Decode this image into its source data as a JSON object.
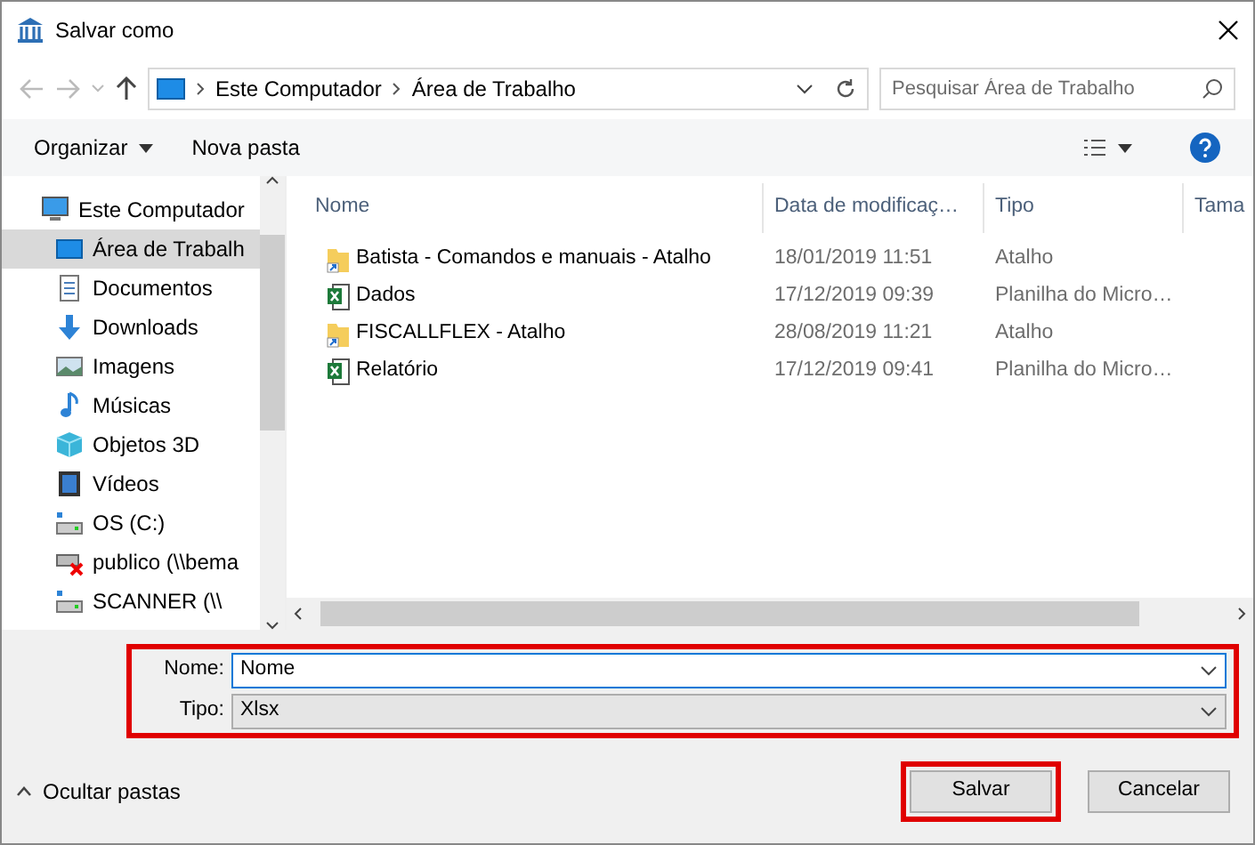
{
  "window": {
    "title": "Salvar como"
  },
  "address_bar": {
    "path": [
      "Este Computador",
      "Área de Trabalho"
    ]
  },
  "search": {
    "placeholder": "Pesquisar Área de Trabalho"
  },
  "toolbar": {
    "organize": "Organizar",
    "new_folder": "Nova pasta"
  },
  "sidebar": {
    "items": [
      {
        "label": "Este Computador",
        "kind": "computer",
        "selected": false,
        "children": [
          {
            "label": "Área de Trabalh",
            "kind": "desktop",
            "selected": true
          },
          {
            "label": "Documentos",
            "kind": "documents",
            "selected": false
          },
          {
            "label": "Downloads",
            "kind": "downloads",
            "selected": false
          },
          {
            "label": "Imagens",
            "kind": "images",
            "selected": false
          },
          {
            "label": "Músicas",
            "kind": "music",
            "selected": false
          },
          {
            "label": "Objetos 3D",
            "kind": "objects3d",
            "selected": false
          },
          {
            "label": "Vídeos",
            "kind": "videos",
            "selected": false
          },
          {
            "label": "OS (C:)",
            "kind": "drive",
            "selected": false
          },
          {
            "label": "publico (\\\\bema",
            "kind": "network_error",
            "selected": false
          },
          {
            "label": "SCANNER (\\\\",
            "kind": "drive",
            "selected": false
          }
        ]
      }
    ]
  },
  "table": {
    "columns": [
      "Nome",
      "Data de modificaç…",
      "Tipo",
      "Tama"
    ],
    "rows": [
      {
        "kind": "shortcut",
        "name": "Batista - Comandos e manuais - Atalho",
        "date": "18/01/2019 11:51",
        "type": "Atalho"
      },
      {
        "kind": "spreadsheet",
        "name": "Dados",
        "date": "17/12/2019 09:39",
        "type": "Planilha do Micro…"
      },
      {
        "kind": "shortcut",
        "name": "FISCALLFLEX - Atalho",
        "date": "28/08/2019 11:21",
        "type": "Atalho"
      },
      {
        "kind": "spreadsheet",
        "name": "Relatório",
        "date": "17/12/2019 09:41",
        "type": "Planilha do Micro…"
      }
    ]
  },
  "form": {
    "highlighted": true,
    "name_label": "Nome:",
    "name_value": "Nome",
    "type_label": "Tipo:",
    "type_value": "Xlsx"
  },
  "hide_folders": "Ocultar pastas",
  "buttons": [
    {
      "label": "Salvar",
      "highlighted": true
    },
    {
      "label": "Cancelar",
      "highlighted": false
    }
  ]
}
